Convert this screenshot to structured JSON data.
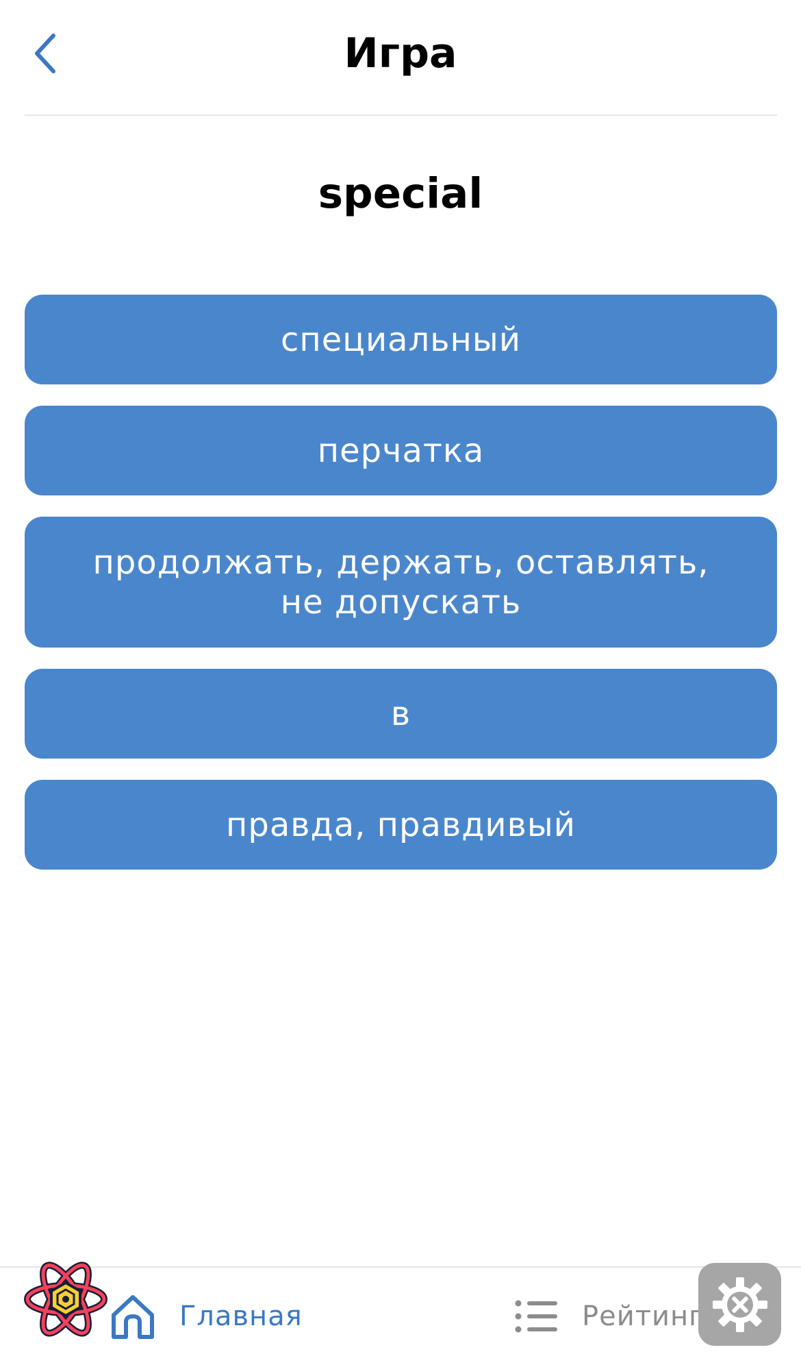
{
  "header": {
    "title": "Игра"
  },
  "game": {
    "word": "special",
    "answers": [
      {
        "label": "специальный"
      },
      {
        "label": "перчатка"
      },
      {
        "label": "продолжать, держать, оставлять,\nне допускать"
      },
      {
        "label": "в"
      },
      {
        "label": "правда, правдивый"
      }
    ]
  },
  "tabbar": {
    "home_label": "Главная",
    "rating_label": "Рейтинг"
  },
  "colors": {
    "accent": "#4a86cb",
    "tab_active": "#3a78c4",
    "tab_inactive": "#8c8c8c"
  },
  "icons": {
    "back": "chevron-left-icon",
    "home": "home-icon",
    "rating": "list-icon",
    "dev": "gear-icon"
  }
}
